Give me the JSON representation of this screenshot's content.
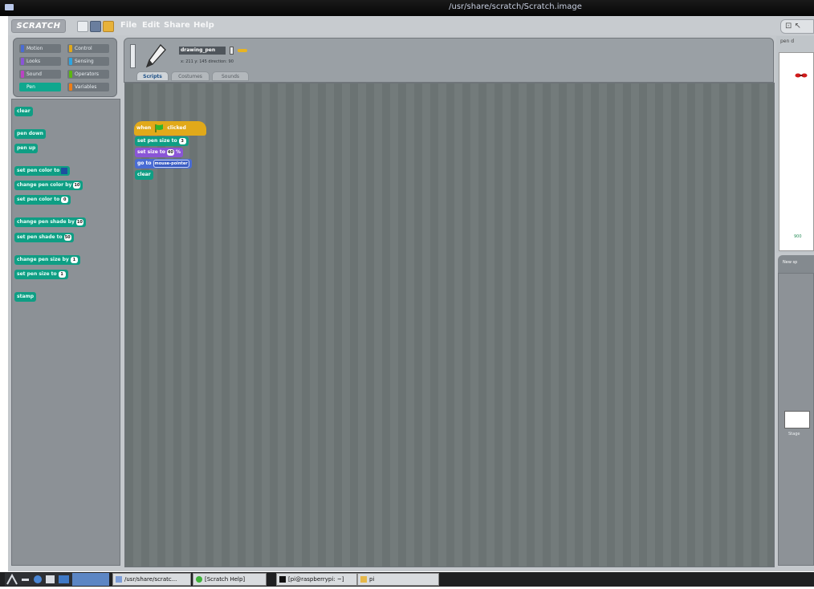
{
  "window": {
    "title": "/usr/share/scratch/Scratch.image"
  },
  "app": {
    "logo": "SCRATCH",
    "menu": [
      "File",
      "Edit",
      "Share",
      "Help"
    ],
    "present_button": "⊡ ↖"
  },
  "categories": [
    {
      "label": "Motion",
      "color": "#4a6cd4"
    },
    {
      "label": "Control",
      "color": "#e1a91a"
    },
    {
      "label": "Looks",
      "color": "#8a55d7"
    },
    {
      "label": "Sensing",
      "color": "#2ca5e2"
    },
    {
      "label": "Sound",
      "color": "#bb42c3"
    },
    {
      "label": "Operators",
      "color": "#5cb712"
    },
    {
      "label": "Pen",
      "color": "#0fa78e"
    },
    {
      "label": "Variables",
      "color": "#ee7d16"
    }
  ],
  "palette": {
    "clear": "clear",
    "pen_down": "pen down",
    "pen_up": "pen up",
    "set_pen_color_to": "set pen color to",
    "change_pen_color_by": "change pen color by",
    "change_pen_color_value": "10",
    "set_pen_color_to_num": "set pen color to",
    "set_pen_color_value": "0",
    "change_pen_shade_by": "change pen shade by",
    "change_pen_shade_value": "10",
    "set_pen_shade_to": "set pen shade to",
    "set_pen_shade_value": "50",
    "change_pen_size_by": "change pen size by",
    "change_pen_size_value": "1",
    "set_pen_size_to": "set pen size to",
    "set_pen_size_value": "1",
    "stamp": "stamp"
  },
  "sprite": {
    "name": "drawing_pen",
    "info": "x: 211  y: 145  direction: 90"
  },
  "tabs": [
    "Scripts",
    "Costumes",
    "Sounds"
  ],
  "script": {
    "hat": "when",
    "hat_suffix": "clicked",
    "set_pen_size": "set pen size to",
    "set_pen_size_value": "3",
    "set_size": "set size to",
    "set_size_value": "40",
    "set_size_unit": "%",
    "go_to": "go to",
    "go_to_target": "mouse-pointer",
    "clear": "clear"
  },
  "stage": {
    "label": "pen d",
    "monitor": "900",
    "sprite_pane_head": "New sp",
    "thumb_label": "Stage"
  },
  "taskbar": {
    "items": [
      "/usr/share/scratc...",
      "[Scratch Help]",
      "[pi@raspberrypi: ~]",
      "pi"
    ]
  }
}
